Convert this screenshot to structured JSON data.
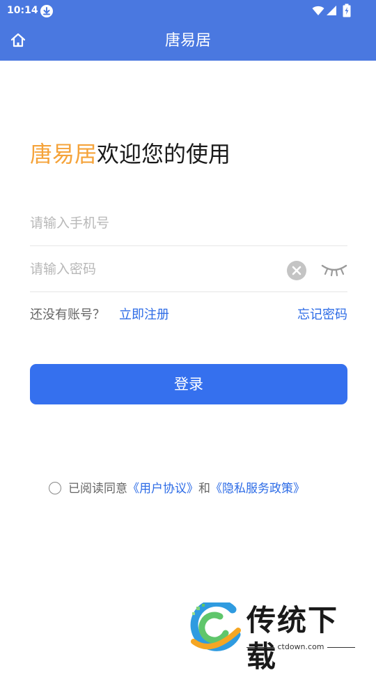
{
  "status_bar": {
    "time": "10:14",
    "icons": [
      "download-icon",
      "wifi-icon",
      "signal-icon",
      "battery-charging-icon"
    ]
  },
  "nav": {
    "title": "唐易居",
    "home_icon": "home-icon"
  },
  "welcome": {
    "brand": "唐易居",
    "text": "欢迎您的使用",
    "brand_color": "#f5a33a"
  },
  "form": {
    "phone_placeholder": "请输入手机号",
    "password_placeholder": "请输入密码",
    "clear_icon": "clear-icon",
    "password_visibility_icon": "eye-closed-icon"
  },
  "links": {
    "no_account": "还没有账号？",
    "register": "立即注册",
    "forgot_password": "忘记密码"
  },
  "login_button": {
    "label": "登录",
    "color": "#3570ee"
  },
  "agreement": {
    "prefix": "已阅读同意",
    "user_agreement": "《用户协议》",
    "and": "和",
    "privacy_policy": "《隐私服务政策》"
  },
  "watermark": {
    "text": "传统下载",
    "sub": "ctdown.com"
  },
  "colors": {
    "header": "#4a78e0",
    "link": "#2c6be6"
  }
}
